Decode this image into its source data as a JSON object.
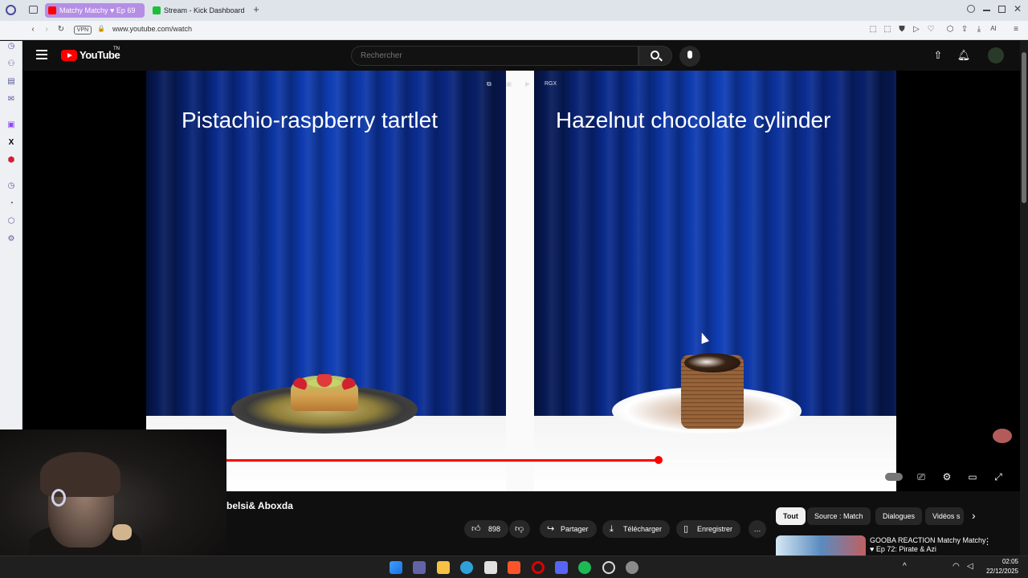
{
  "browser": {
    "tabs": [
      {
        "label": "Matchy Matchy ♥ Ep 69",
        "active": true
      },
      {
        "label": "Stream - Kick Dashboard",
        "active": false
      }
    ],
    "url": "www.youtube.com/watch"
  },
  "youtube": {
    "logo_text": "YouTube",
    "logo_sup": "TN",
    "search_placeholder": "Rechercher"
  },
  "video": {
    "left_title": "Pistachio-raspberry tartlet",
    "right_title": "Hazelnut chocolate cylinder",
    "overlay_label": "RGX",
    "progress": 0.645,
    "buffered": 0.75
  },
  "below_video": {
    "title_partial": "belsi& Aboxda",
    "like_count": "898",
    "share_label": "Partager",
    "download_label": "Télécharger",
    "save_label": "Enregistrer",
    "more_label": "…"
  },
  "recommendations": {
    "chips": [
      {
        "label": "Tout",
        "active": true
      },
      {
        "label": "Source : Match",
        "active": false
      },
      {
        "label": "Dialogues",
        "active": false
      },
      {
        "label": "Vidéos s",
        "active": false
      }
    ],
    "first_item_title": "GOOBA REACTION Matchy Matchy ♥ Ep 72: Pirate & Azi"
  },
  "taskbar": {
    "time": "02:05",
    "date": "22/12/2025"
  },
  "colors": {
    "accent": "#ff0000",
    "tab_active": "#b58ee6"
  }
}
